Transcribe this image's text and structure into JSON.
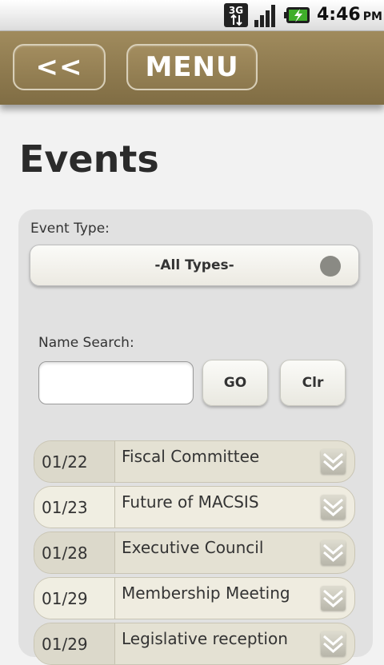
{
  "status_bar": {
    "network": "3G",
    "time": "4:46",
    "ampm": "PM",
    "icons": [
      "3g-data-icon",
      "signal-icon",
      "battery-charging-icon"
    ]
  },
  "header": {
    "back_label": "<<",
    "menu_label": "MENU",
    "bar_color": "#8e7a4f"
  },
  "page": {
    "title": "Events"
  },
  "filters": {
    "event_type_label": "Event Type:",
    "event_type_value": "-All Types-",
    "name_search_label": "Name Search:",
    "name_search_value": "",
    "go_label": "GO",
    "clear_label": "Clr"
  },
  "events": [
    {
      "date": "01/22",
      "name": "Fiscal Committee"
    },
    {
      "date": "01/23",
      "name": "Future of MACSIS"
    },
    {
      "date": "01/28",
      "name": "Executive Council"
    },
    {
      "date": "01/29",
      "name": "Membership Meeting"
    },
    {
      "date": "01/29",
      "name": "Legislative reception"
    }
  ]
}
